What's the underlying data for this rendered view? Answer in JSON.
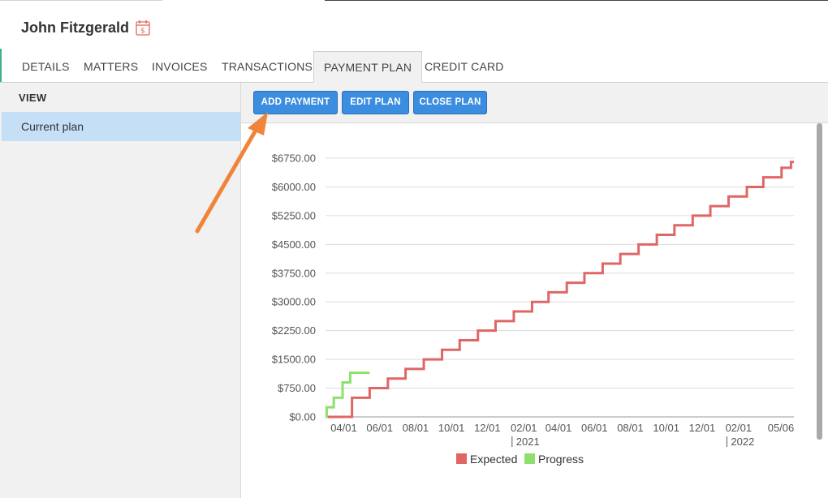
{
  "client": {
    "name": "John Fitzgerald",
    "icon": "calendar-dollar-icon"
  },
  "tabs": [
    {
      "label": "DETAILS",
      "active": false
    },
    {
      "label": "MATTERS",
      "active": false
    },
    {
      "label": "INVOICES",
      "active": false
    },
    {
      "label": "TRANSACTIONS",
      "active": false
    },
    {
      "label": "PAYMENT PLAN",
      "active": true
    },
    {
      "label": "CREDIT CARD",
      "active": false
    }
  ],
  "sidebar": {
    "heading": "VIEW",
    "items": [
      {
        "label": "Current plan",
        "selected": true
      }
    ]
  },
  "toolbar": {
    "add_payment_label": "ADD PAYMENT",
    "edit_plan_label": "EDIT PLAN",
    "close_plan_label": "CLOSE PLAN"
  },
  "colors": {
    "accent": "#3b8de0",
    "expected": "#e06666",
    "progress": "#8ee06e",
    "annotation_arrow": "#f0843a"
  },
  "chart_data": {
    "type": "line",
    "step": "after",
    "x_type": "date",
    "ylim": [
      0,
      6750
    ],
    "y_ticks": [
      "$0.00",
      "$750.00",
      "$1500.00",
      "$2250.00",
      "$3000.00",
      "$3750.00",
      "$4500.00",
      "$5250.00",
      "$6000.00",
      "$6750.00"
    ],
    "x_ticks": [
      "04/01",
      "06/01",
      "08/01",
      "10/01",
      "12/01",
      "02/01",
      "04/01",
      "06/01",
      "08/01",
      "10/01",
      "12/01",
      "02/01",
      "05/06"
    ],
    "year_markers": [
      "2021",
      "2022"
    ],
    "grid": true,
    "legend": "bottom",
    "series": [
      {
        "name": "Expected",
        "color": "#e06666",
        "step_dates": [
          "2020-03-01",
          "2020-04-15",
          "2020-05-15",
          "2020-06-15",
          "2020-07-15",
          "2020-08-15",
          "2020-09-15",
          "2020-10-15",
          "2020-11-15",
          "2020-12-15",
          "2021-01-15",
          "2021-02-15",
          "2021-03-15",
          "2021-04-15",
          "2021-05-15",
          "2021-06-15",
          "2021-07-15",
          "2021-08-15",
          "2021-09-15",
          "2021-10-15",
          "2021-11-15",
          "2021-12-15",
          "2022-01-15",
          "2022-02-15",
          "2022-03-15",
          "2022-04-15",
          "2022-05-01",
          "2022-05-06"
        ],
        "values": [
          0,
          500,
          750,
          1000,
          1250,
          1500,
          1750,
          2000,
          2250,
          2500,
          2750,
          3000,
          3250,
          3500,
          3750,
          4000,
          4250,
          4500,
          4750,
          5000,
          5250,
          5500,
          5750,
          6000,
          6250,
          6500,
          6650,
          6650
        ]
      },
      {
        "name": "Progress",
        "color": "#8ee06e",
        "step_dates": [
          "2020-03-01",
          "2020-03-03",
          "2020-03-15",
          "2020-03-30",
          "2020-04-12",
          "2020-04-28",
          "2020-05-15"
        ],
        "values": [
          0,
          250,
          500,
          900,
          1150,
          1150,
          1150
        ]
      }
    ]
  }
}
